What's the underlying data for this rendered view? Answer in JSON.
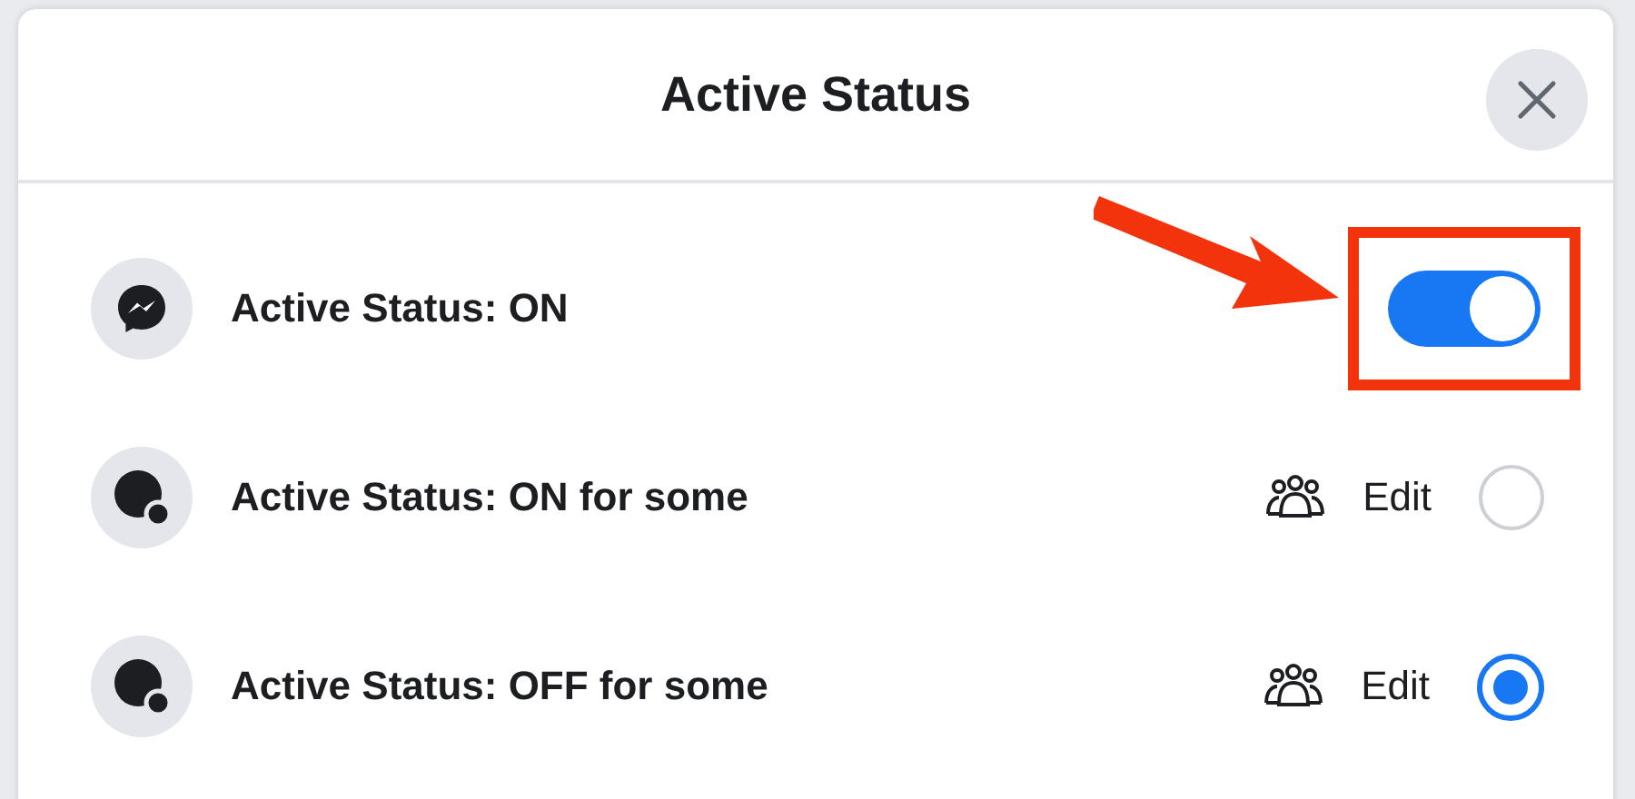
{
  "dialog": {
    "title": "Active Status"
  },
  "options": [
    {
      "kind": "toggle",
      "label": "Active Status: ON",
      "on": true
    },
    {
      "kind": "radio",
      "label": "Active Status: ON for some",
      "edit_label": "Edit",
      "selected": false
    },
    {
      "kind": "radio",
      "label": "Active Status: OFF for some",
      "edit_label": "Edit",
      "selected": true
    }
  ]
}
